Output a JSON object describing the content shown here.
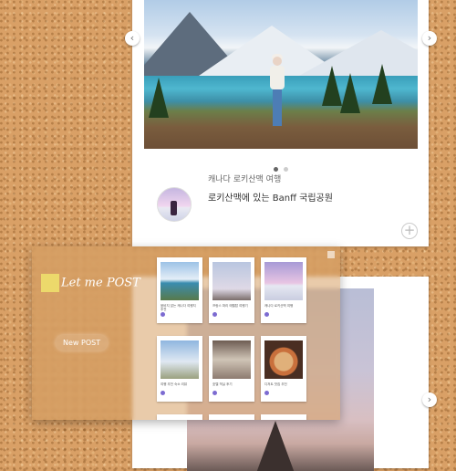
{
  "post": {
    "category": "캐나다 로키산맥 여행",
    "title": "로키산맥에 있는 Banff 국립공원"
  },
  "carousel": {
    "prev_icon": "‹",
    "next_icon": "›",
    "slide_count": 2,
    "active_index": 0
  },
  "add_icon": "+",
  "panel": {
    "logo_text": "Let me POST",
    "new_post_label": "New POST",
    "tiles": [
      {
        "img": "lake",
        "caption": "붐비지 않는 캐나다 여행지 추천"
      },
      {
        "img": "tower",
        "caption": "프랑스 파리 에펠탑 여행기"
      },
      {
        "img": "snow",
        "caption": "캐나다 로키산맥 여행"
      },
      {
        "img": "house",
        "caption": "여행 추천 숙소 리뷰"
      },
      {
        "img": "room",
        "caption": "호텔 객실 후기"
      },
      {
        "img": "food",
        "caption": "디저트 맛집 추천"
      }
    ]
  },
  "colors": {
    "accent": "#7c6bd1",
    "sticky": "#ecd96b"
  }
}
